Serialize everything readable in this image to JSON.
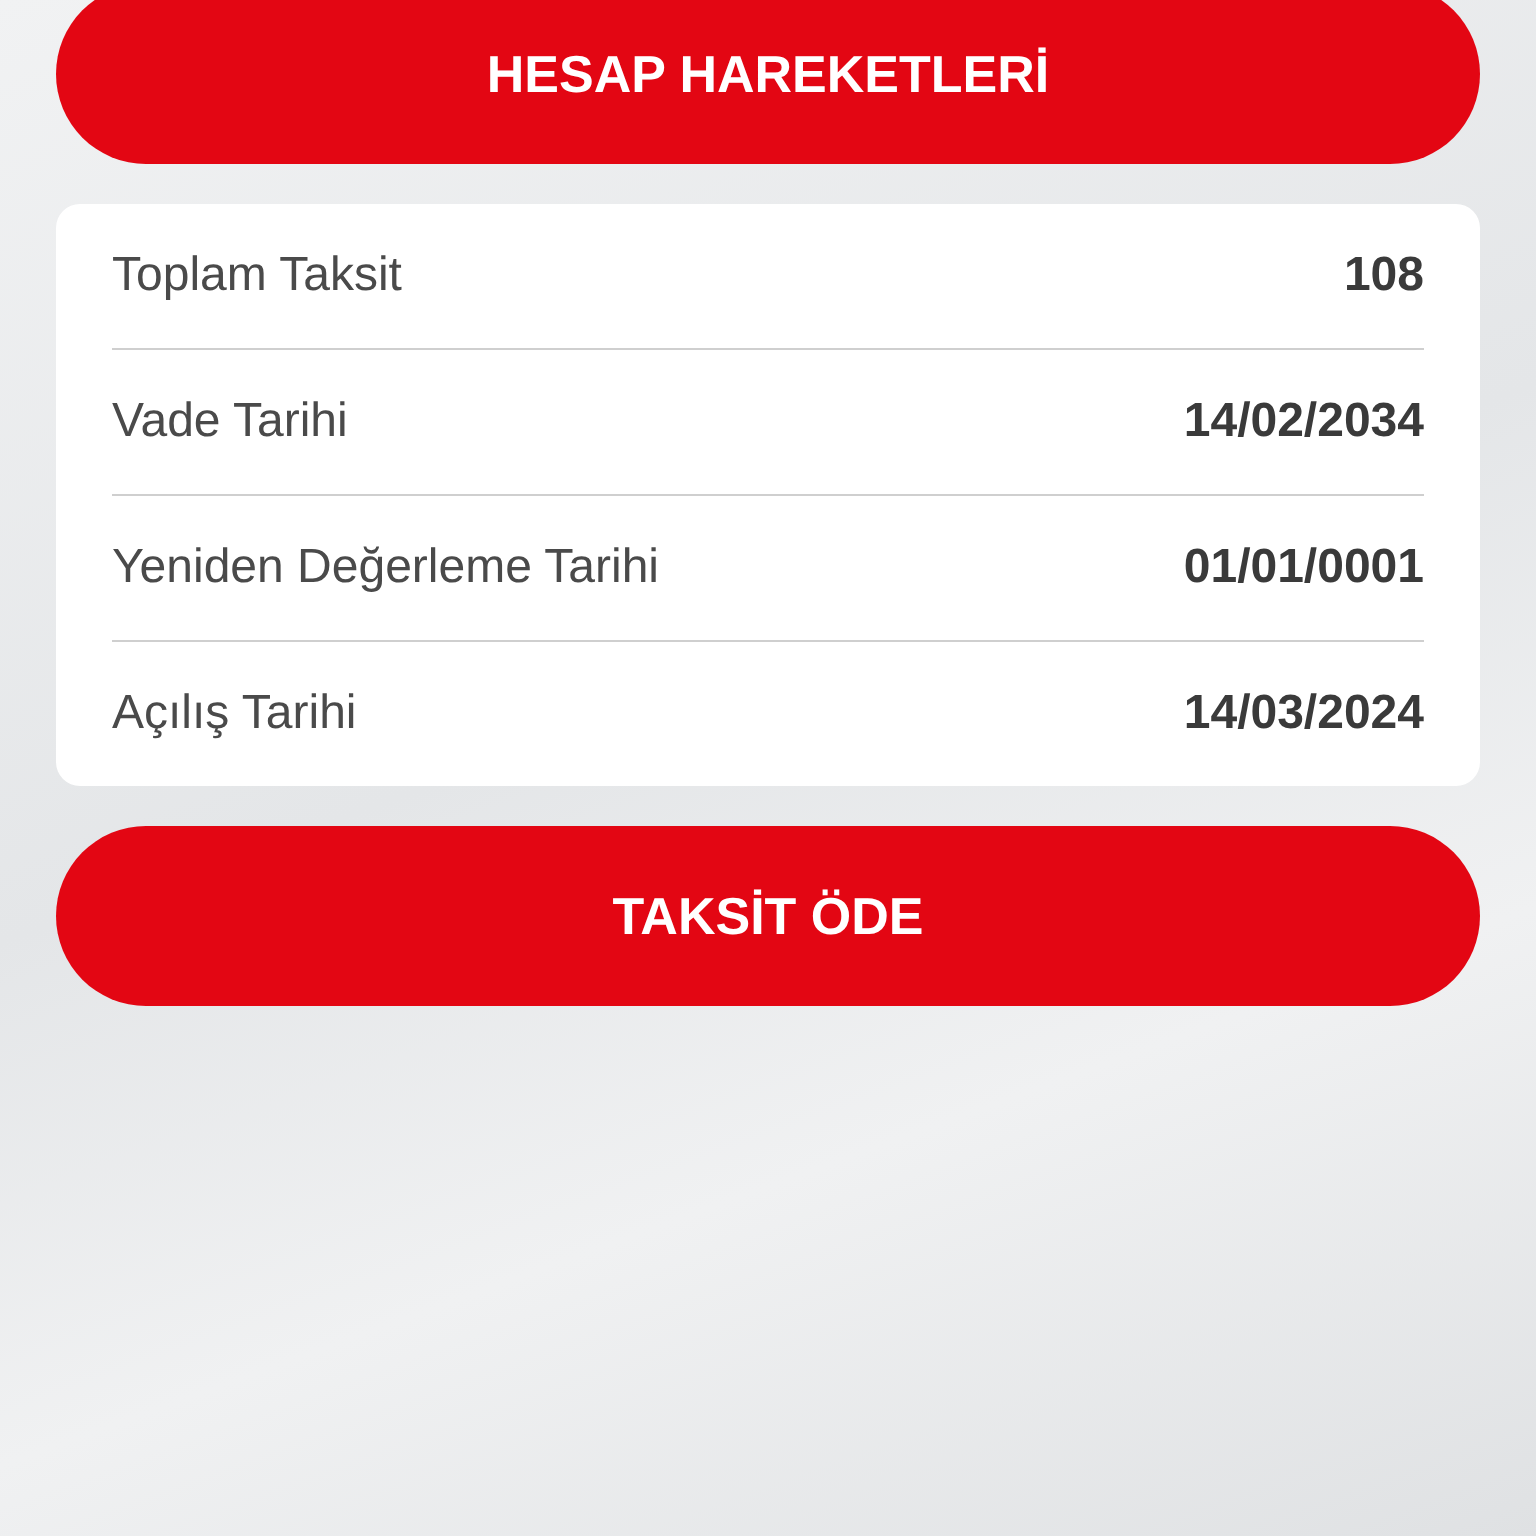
{
  "buttons_top": {
    "label": "HESAP HAREKETLERİ"
  },
  "details": [
    {
      "label": "Toplam Taksit",
      "value": "108"
    },
    {
      "label": "Vade Tarihi",
      "value": "14/02/2034"
    },
    {
      "label": "Yeniden Değerleme Tarihi",
      "value": "01/01/0001"
    },
    {
      "label": "Açılış Tarihi",
      "value": "14/03/2024"
    }
  ],
  "buttons_bottom": {
    "label": "TAKSİT ÖDE"
  }
}
